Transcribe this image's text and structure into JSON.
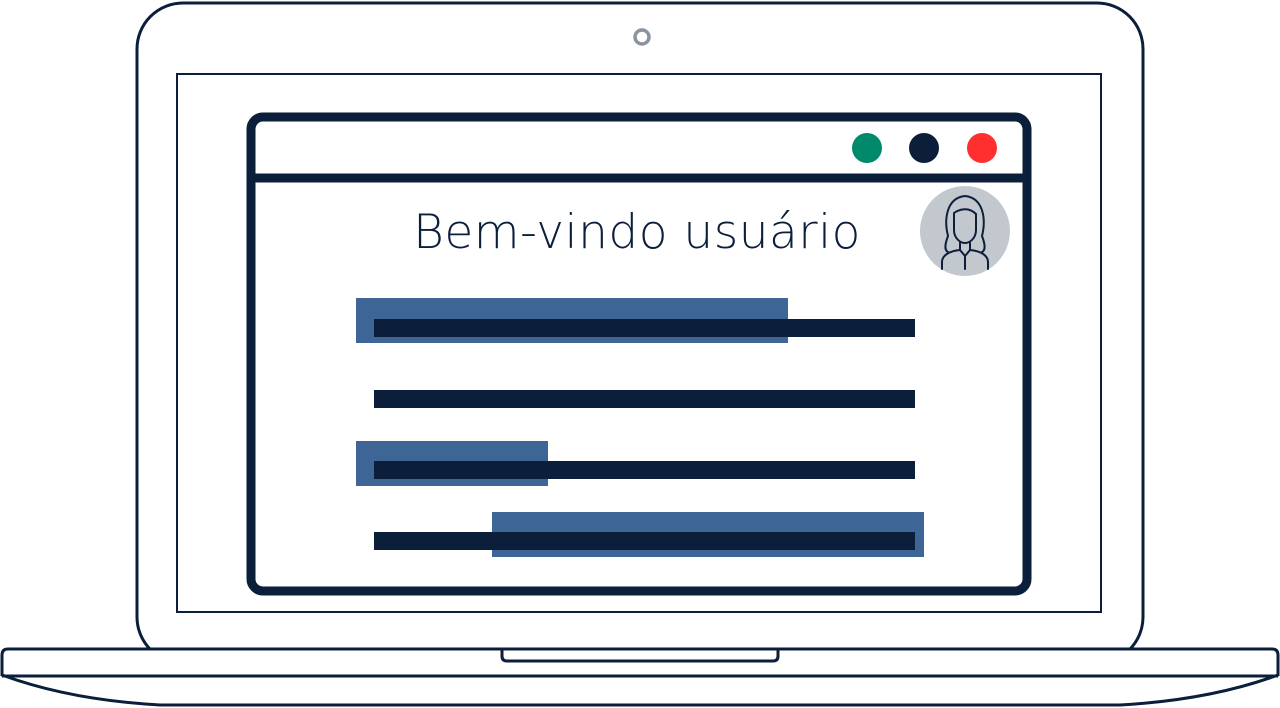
{
  "window": {
    "controls": [
      {
        "name": "maximize",
        "color": "#00896b"
      },
      {
        "name": "minimize",
        "color": "#0b1f3a"
      },
      {
        "name": "close",
        "color": "#ff2f2f"
      }
    ]
  },
  "main": {
    "welcome_title": "Bem-vindo usuário"
  },
  "user": {
    "avatar_icon": "female-user-icon",
    "avatar_bg": "#c3c8cf"
  },
  "colors": {
    "outline": "#0b1f3a",
    "highlight": "#3d6696",
    "background": "#ffffff"
  },
  "content_lines": [
    {
      "highlighted": true
    },
    {
      "highlighted": false
    },
    {
      "highlighted": true
    },
    {
      "highlighted": true
    }
  ]
}
